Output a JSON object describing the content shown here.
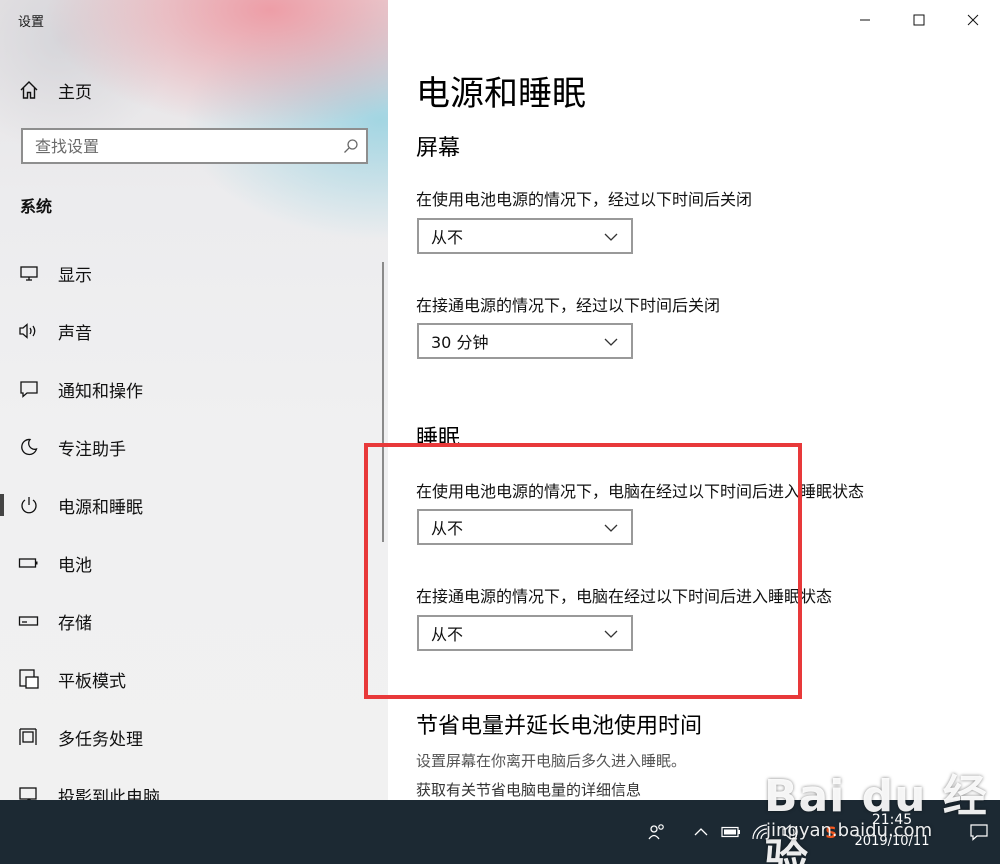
{
  "app": {
    "title": "设置"
  },
  "sidebar": {
    "home_label": "主页",
    "search_placeholder": "查找设置",
    "section_label": "系统",
    "items": [
      {
        "label": "显示",
        "icon": "monitor-icon"
      },
      {
        "label": "声音",
        "icon": "speaker-icon"
      },
      {
        "label": "通知和操作",
        "icon": "notification-icon"
      },
      {
        "label": "专注助手",
        "icon": "moon-icon"
      },
      {
        "label": "电源和睡眠",
        "icon": "power-icon",
        "active": true
      },
      {
        "label": "电池",
        "icon": "battery-icon"
      },
      {
        "label": "存储",
        "icon": "storage-icon"
      },
      {
        "label": "平板模式",
        "icon": "tablet-icon"
      },
      {
        "label": "多任务处理",
        "icon": "multitask-icon"
      },
      {
        "label": "投影到此电脑",
        "icon": "project-icon"
      }
    ]
  },
  "content": {
    "page_title": "电源和睡眠",
    "screen": {
      "heading": "屏幕",
      "battery_label": "在使用电池电源的情况下，经过以下时间后关闭",
      "battery_value": "从不",
      "plugged_label": "在接通电源的情况下，经过以下时间后关闭",
      "plugged_value": "30 分钟"
    },
    "sleep": {
      "heading": "睡眠",
      "battery_label": "在使用电池电源的情况下，电脑在经过以下时间后进入睡眠状态",
      "battery_value": "从不",
      "plugged_label": "在接通电源的情况下，电脑在经过以下时间后进入睡眠状态",
      "plugged_value": "从不"
    },
    "save": {
      "heading": "节省电量并延长电池使用时间",
      "desc": "设置屏幕在你离开电脑后多久进入睡眠。",
      "link": "获取有关节省电脑电量的详细信息"
    }
  },
  "taskbar": {
    "time": "21:45",
    "date": "2019/10/11",
    "ime_label": "S"
  },
  "watermark": {
    "logo": "Bai du 经验",
    "url": "jingyan.baidu.com"
  },
  "colors": {
    "highlight": "#e8393a",
    "taskbar": "#1c2933"
  }
}
